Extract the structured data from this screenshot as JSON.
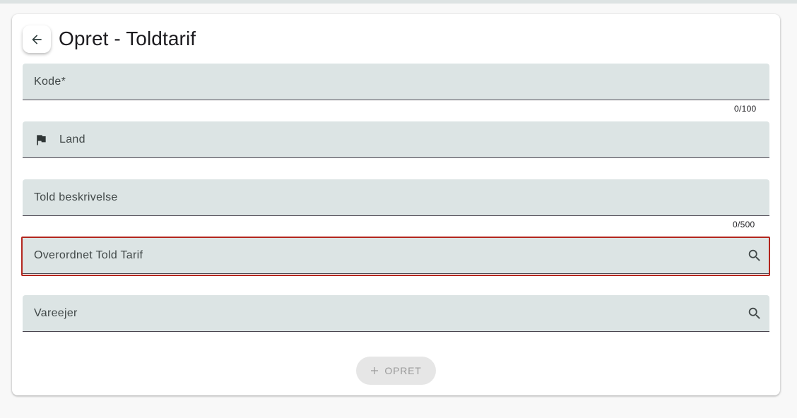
{
  "header": {
    "title": "Opret - Toldtarif",
    "back_icon": "arrow-left-icon"
  },
  "form": {
    "kode": {
      "label": "Kode*",
      "value": "",
      "counter": "0/100"
    },
    "land": {
      "label": "Land",
      "value": "",
      "icon": "flag-icon"
    },
    "told_beskrivelse": {
      "label": "Told beskrivelse",
      "value": "",
      "counter": "0/500"
    },
    "overordnet_told_tarif": {
      "label": "Overordnet Told Tarif",
      "value": "",
      "icon": "search-icon",
      "focused": true
    },
    "vareejer": {
      "label": "Vareejer",
      "value": "",
      "icon": "search-icon"
    }
  },
  "actions": {
    "create_label": "OPRET",
    "create_icon": "plus-icon",
    "create_disabled": true
  },
  "colors": {
    "field_bg": "#dce4e4",
    "focus_outline": "#b3261e",
    "disabled_button_bg": "#e6e6e6"
  }
}
